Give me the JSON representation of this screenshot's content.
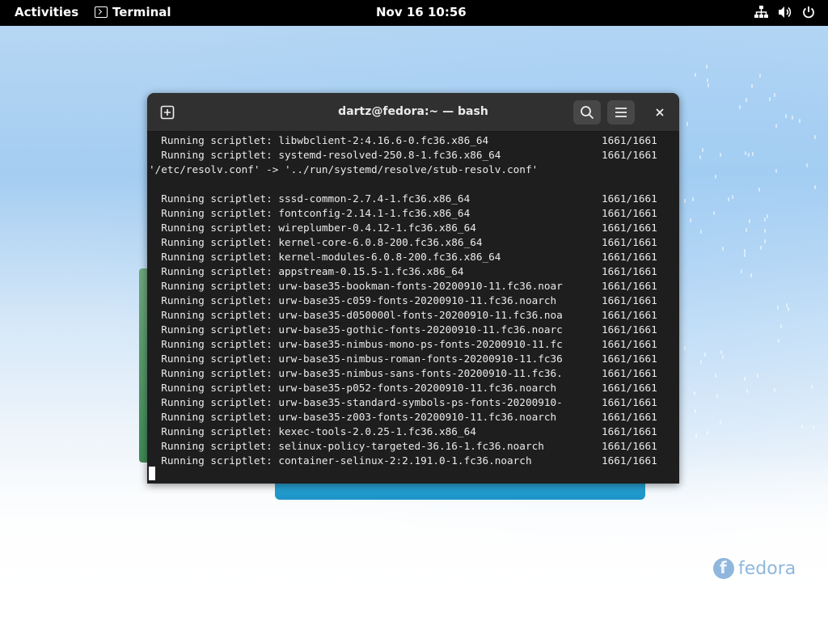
{
  "topbar": {
    "activities": "Activities",
    "app_name": "Terminal",
    "clock": "Nov 16  10:56",
    "tray_icons": [
      "network-icon",
      "volume-icon",
      "power-icon"
    ]
  },
  "terminal": {
    "title": "dartz@fedora:~ — bash",
    "lines": [
      {
        "text": "  Running scriptlet: libwbclient-2:4.16.6-0.fc36.x86_64",
        "progress": "1661/1661"
      },
      {
        "text": "  Running scriptlet: systemd-resolved-250.8-1.fc36.x86_64",
        "progress": "1661/1661"
      },
      {
        "text": "'/etc/resolv.conf' -> '../run/systemd/resolve/stub-resolv.conf'",
        "progress": ""
      },
      {
        "text": "",
        "progress": ""
      },
      {
        "text": "  Running scriptlet: sssd-common-2.7.4-1.fc36.x86_64",
        "progress": "1661/1661"
      },
      {
        "text": "  Running scriptlet: fontconfig-2.14.1-1.fc36.x86_64",
        "progress": "1661/1661"
      },
      {
        "text": "  Running scriptlet: wireplumber-0.4.12-1.fc36.x86_64",
        "progress": "1661/1661"
      },
      {
        "text": "  Running scriptlet: kernel-core-6.0.8-200.fc36.x86_64",
        "progress": "1661/1661"
      },
      {
        "text": "  Running scriptlet: kernel-modules-6.0.8-200.fc36.x86_64",
        "progress": "1661/1661"
      },
      {
        "text": "  Running scriptlet: appstream-0.15.5-1.fc36.x86_64",
        "progress": "1661/1661"
      },
      {
        "text": "  Running scriptlet: urw-base35-bookman-fonts-20200910-11.fc36.noar",
        "progress": "1661/1661"
      },
      {
        "text": "  Running scriptlet: urw-base35-c059-fonts-20200910-11.fc36.noarch",
        "progress": "1661/1661"
      },
      {
        "text": "  Running scriptlet: urw-base35-d050000l-fonts-20200910-11.fc36.noa",
        "progress": "1661/1661"
      },
      {
        "text": "  Running scriptlet: urw-base35-gothic-fonts-20200910-11.fc36.noarc",
        "progress": "1661/1661"
      },
      {
        "text": "  Running scriptlet: urw-base35-nimbus-mono-ps-fonts-20200910-11.fc",
        "progress": "1661/1661"
      },
      {
        "text": "  Running scriptlet: urw-base35-nimbus-roman-fonts-20200910-11.fc36",
        "progress": "1661/1661"
      },
      {
        "text": "  Running scriptlet: urw-base35-nimbus-sans-fonts-20200910-11.fc36.",
        "progress": "1661/1661"
      },
      {
        "text": "  Running scriptlet: urw-base35-p052-fonts-20200910-11.fc36.noarch",
        "progress": "1661/1661"
      },
      {
        "text": "  Running scriptlet: urw-base35-standard-symbols-ps-fonts-20200910-",
        "progress": "1661/1661"
      },
      {
        "text": "  Running scriptlet: urw-base35-z003-fonts-20200910-11.fc36.noarch",
        "progress": "1661/1661"
      },
      {
        "text": "  Running scriptlet: kexec-tools-2.0.25-1.fc36.x86_64",
        "progress": "1661/1661"
      },
      {
        "text": "  Running scriptlet: selinux-policy-targeted-36.16-1.fc36.noarch",
        "progress": "1661/1661"
      },
      {
        "text": "  Running scriptlet: container-selinux-2:2.191.0-1.fc36.noarch",
        "progress": "1661/1661"
      }
    ]
  },
  "wallpaper": {
    "logo_text": "fedora"
  },
  "colors": {
    "terminal_bg": "#1e1e1e",
    "titlebar_bg": "#303030",
    "topbar_bg": "#000000"
  }
}
